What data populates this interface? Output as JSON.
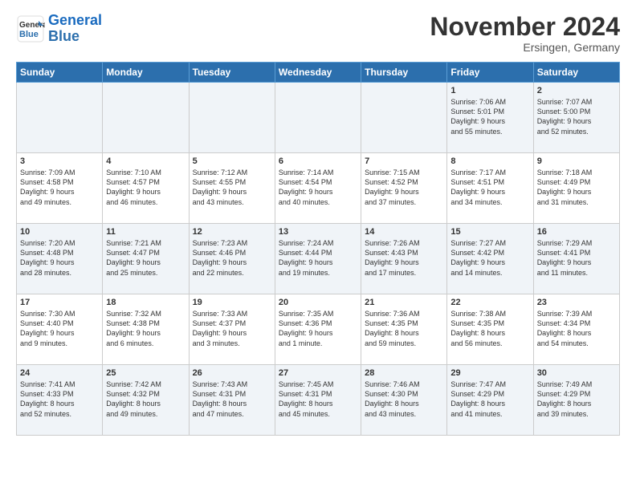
{
  "logo": {
    "line1": "General",
    "line2": "Blue"
  },
  "title": "November 2024",
  "location": "Ersingen, Germany",
  "days_of_week": [
    "Sunday",
    "Monday",
    "Tuesday",
    "Wednesday",
    "Thursday",
    "Friday",
    "Saturday"
  ],
  "weeks": [
    [
      {
        "day": "",
        "info": ""
      },
      {
        "day": "",
        "info": ""
      },
      {
        "day": "",
        "info": ""
      },
      {
        "day": "",
        "info": ""
      },
      {
        "day": "",
        "info": ""
      },
      {
        "day": "1",
        "info": "Sunrise: 7:06 AM\nSunset: 5:01 PM\nDaylight: 9 hours\nand 55 minutes."
      },
      {
        "day": "2",
        "info": "Sunrise: 7:07 AM\nSunset: 5:00 PM\nDaylight: 9 hours\nand 52 minutes."
      }
    ],
    [
      {
        "day": "3",
        "info": "Sunrise: 7:09 AM\nSunset: 4:58 PM\nDaylight: 9 hours\nand 49 minutes."
      },
      {
        "day": "4",
        "info": "Sunrise: 7:10 AM\nSunset: 4:57 PM\nDaylight: 9 hours\nand 46 minutes."
      },
      {
        "day": "5",
        "info": "Sunrise: 7:12 AM\nSunset: 4:55 PM\nDaylight: 9 hours\nand 43 minutes."
      },
      {
        "day": "6",
        "info": "Sunrise: 7:14 AM\nSunset: 4:54 PM\nDaylight: 9 hours\nand 40 minutes."
      },
      {
        "day": "7",
        "info": "Sunrise: 7:15 AM\nSunset: 4:52 PM\nDaylight: 9 hours\nand 37 minutes."
      },
      {
        "day": "8",
        "info": "Sunrise: 7:17 AM\nSunset: 4:51 PM\nDaylight: 9 hours\nand 34 minutes."
      },
      {
        "day": "9",
        "info": "Sunrise: 7:18 AM\nSunset: 4:49 PM\nDaylight: 9 hours\nand 31 minutes."
      }
    ],
    [
      {
        "day": "10",
        "info": "Sunrise: 7:20 AM\nSunset: 4:48 PM\nDaylight: 9 hours\nand 28 minutes."
      },
      {
        "day": "11",
        "info": "Sunrise: 7:21 AM\nSunset: 4:47 PM\nDaylight: 9 hours\nand 25 minutes."
      },
      {
        "day": "12",
        "info": "Sunrise: 7:23 AM\nSunset: 4:46 PM\nDaylight: 9 hours\nand 22 minutes."
      },
      {
        "day": "13",
        "info": "Sunrise: 7:24 AM\nSunset: 4:44 PM\nDaylight: 9 hours\nand 19 minutes."
      },
      {
        "day": "14",
        "info": "Sunrise: 7:26 AM\nSunset: 4:43 PM\nDaylight: 9 hours\nand 17 minutes."
      },
      {
        "day": "15",
        "info": "Sunrise: 7:27 AM\nSunset: 4:42 PM\nDaylight: 9 hours\nand 14 minutes."
      },
      {
        "day": "16",
        "info": "Sunrise: 7:29 AM\nSunset: 4:41 PM\nDaylight: 9 hours\nand 11 minutes."
      }
    ],
    [
      {
        "day": "17",
        "info": "Sunrise: 7:30 AM\nSunset: 4:40 PM\nDaylight: 9 hours\nand 9 minutes."
      },
      {
        "day": "18",
        "info": "Sunrise: 7:32 AM\nSunset: 4:38 PM\nDaylight: 9 hours\nand 6 minutes."
      },
      {
        "day": "19",
        "info": "Sunrise: 7:33 AM\nSunset: 4:37 PM\nDaylight: 9 hours\nand 3 minutes."
      },
      {
        "day": "20",
        "info": "Sunrise: 7:35 AM\nSunset: 4:36 PM\nDaylight: 9 hours\nand 1 minute."
      },
      {
        "day": "21",
        "info": "Sunrise: 7:36 AM\nSunset: 4:35 PM\nDaylight: 8 hours\nand 59 minutes."
      },
      {
        "day": "22",
        "info": "Sunrise: 7:38 AM\nSunset: 4:35 PM\nDaylight: 8 hours\nand 56 minutes."
      },
      {
        "day": "23",
        "info": "Sunrise: 7:39 AM\nSunset: 4:34 PM\nDaylight: 8 hours\nand 54 minutes."
      }
    ],
    [
      {
        "day": "24",
        "info": "Sunrise: 7:41 AM\nSunset: 4:33 PM\nDaylight: 8 hours\nand 52 minutes."
      },
      {
        "day": "25",
        "info": "Sunrise: 7:42 AM\nSunset: 4:32 PM\nDaylight: 8 hours\nand 49 minutes."
      },
      {
        "day": "26",
        "info": "Sunrise: 7:43 AM\nSunset: 4:31 PM\nDaylight: 8 hours\nand 47 minutes."
      },
      {
        "day": "27",
        "info": "Sunrise: 7:45 AM\nSunset: 4:31 PM\nDaylight: 8 hours\nand 45 minutes."
      },
      {
        "day": "28",
        "info": "Sunrise: 7:46 AM\nSunset: 4:30 PM\nDaylight: 8 hours\nand 43 minutes."
      },
      {
        "day": "29",
        "info": "Sunrise: 7:47 AM\nSunset: 4:29 PM\nDaylight: 8 hours\nand 41 minutes."
      },
      {
        "day": "30",
        "info": "Sunrise: 7:49 AM\nSunset: 4:29 PM\nDaylight: 8 hours\nand 39 minutes."
      }
    ]
  ]
}
